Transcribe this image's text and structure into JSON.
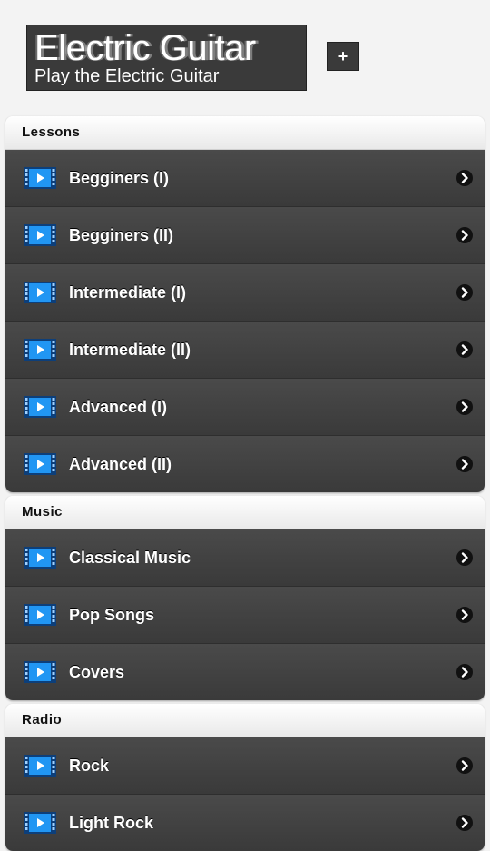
{
  "app": {
    "title": "Electric Guitar",
    "subtitle": "Play the Electric Guitar",
    "add_button_label": "+"
  },
  "sections": [
    {
      "title": "Lessons",
      "items": [
        "Begginers (I)",
        "Begginers (II)",
        "Intermediate (I)",
        "Intermediate (II)",
        "Advanced (I)",
        "Advanced (II)"
      ]
    },
    {
      "title": "Music",
      "items": [
        "Classical Music",
        "Pop Songs",
        "Covers"
      ]
    },
    {
      "title": "Radio",
      "items": [
        "Rock",
        "Light Rock"
      ]
    }
  ],
  "icons": {
    "item_icon": "video-play-icon",
    "item_arrow": "chevron-right-icon"
  },
  "colors": {
    "list_background": "#414141",
    "section_header": "#f5f5f5",
    "icon_blue": "#1e88e5"
  }
}
